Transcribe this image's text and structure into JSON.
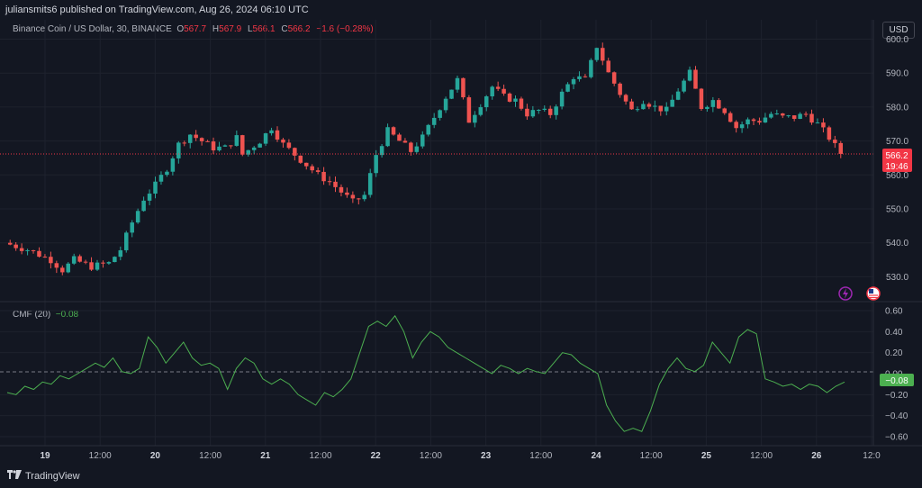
{
  "header": {
    "publisher": "juliansmits6 published on TradingView.com, Aug 26, 2024 06:10 UTC"
  },
  "symbol": {
    "title": "Binance Coin / US Dollar, 30, BINANCE",
    "o_label": "O",
    "o_value": "567.7",
    "h_label": "H",
    "h_value": "567.9",
    "l_label": "L",
    "l_value": "566.1",
    "c_label": "C",
    "c_value": "566.2",
    "change": "−1.6 (−0.28%)"
  },
  "currency_button": "USD",
  "price_badge": {
    "price": "566.2",
    "countdown": "19:46"
  },
  "indicator": {
    "name": "CMF (20)",
    "value": "−0.08",
    "badge": "−0.08"
  },
  "footer": {
    "brand": "TradingView"
  },
  "icons": [
    "lightning-icon",
    "us-flag-icon",
    "tradingview-logo-icon"
  ],
  "colors": {
    "up": "#26a69a",
    "down": "#ef5350",
    "cmf": "#4caf50",
    "badge": "#f23645",
    "background": "#131722"
  },
  "chart_data": [
    {
      "type": "candlestick",
      "title": "Binance Coin / US Dollar, 30, BINANCE",
      "x_ticks": [
        "19",
        "12:00",
        "20",
        "12:00",
        "21",
        "12:00",
        "22",
        "12:00",
        "23",
        "12:00",
        "24",
        "12:00",
        "25",
        "12:00",
        "26",
        "12:0"
      ],
      "y_ticks": [
        "530.0",
        "540.0",
        "550.0",
        "560.0",
        "570.0",
        "580.0",
        "590.0",
        "600.0"
      ],
      "ylim": [
        524,
        602
      ],
      "grid": true,
      "close_path": [
        [
          0,
          540
        ],
        [
          4,
          538
        ],
        [
          8,
          535
        ],
        [
          10,
          532
        ],
        [
          12,
          535
        ],
        [
          15,
          533
        ],
        [
          18,
          534
        ],
        [
          20,
          538
        ],
        [
          22,
          546
        ],
        [
          24,
          553
        ],
        [
          26,
          557
        ],
        [
          28,
          562
        ],
        [
          30,
          569
        ],
        [
          32,
          572
        ],
        [
          34,
          570
        ],
        [
          36,
          568
        ],
        [
          38,
          568
        ],
        [
          40,
          571
        ],
        [
          41,
          566
        ],
        [
          44,
          570
        ],
        [
          46,
          574
        ],
        [
          48,
          569
        ],
        [
          50,
          566
        ],
        [
          52,
          563
        ],
        [
          54,
          560
        ],
        [
          56,
          558
        ],
        [
          58,
          555
        ],
        [
          60,
          552
        ],
        [
          62,
          554
        ],
        [
          64,
          566
        ],
        [
          66,
          573
        ],
        [
          68,
          570
        ],
        [
          70,
          567
        ],
        [
          72,
          571
        ],
        [
          74,
          577
        ],
        [
          76,
          583
        ],
        [
          78,
          588
        ],
        [
          80,
          576
        ],
        [
          82,
          581
        ],
        [
          84,
          586
        ],
        [
          86,
          583
        ],
        [
          88,
          582
        ],
        [
          90,
          578
        ],
        [
          92,
          579
        ],
        [
          94,
          578
        ],
        [
          96,
          584
        ],
        [
          98,
          589
        ],
        [
          100,
          588
        ],
        [
          102,
          598
        ],
        [
          104,
          590
        ],
        [
          106,
          584
        ],
        [
          108,
          579
        ],
        [
          110,
          582
        ],
        [
          112,
          580
        ],
        [
          114,
          579
        ],
        [
          116,
          585
        ],
        [
          118,
          590
        ],
        [
          120,
          580
        ],
        [
          122,
          582
        ],
        [
          124,
          579
        ],
        [
          126,
          574
        ],
        [
          128,
          576
        ],
        [
          130,
          576
        ],
        [
          132,
          578
        ],
        [
          134,
          577
        ],
        [
          136,
          577
        ],
        [
          138,
          578
        ],
        [
          140,
          575
        ],
        [
          142,
          571
        ],
        [
          144,
          566
        ]
      ],
      "last_close": 566.2
    },
    {
      "type": "line",
      "title": "CMF (20)",
      "y_ticks": [
        "−0.60",
        "−0.40",
        "−0.20",
        "0.00",
        "0.20",
        "0.40",
        "0.60"
      ],
      "ylim": [
        -0.66,
        0.66
      ],
      "zero_line": true,
      "series": [
        {
          "values": [
            -0.18,
            -0.2,
            -0.12,
            -0.15,
            -0.08,
            -0.1,
            -0.02,
            -0.05,
            0.0,
            0.05,
            0.1,
            0.06,
            0.15,
            0.02,
            0.0,
            0.05,
            0.35,
            0.25,
            0.1,
            0.2,
            0.3,
            0.15,
            0.08,
            0.1,
            0.05,
            -0.15,
            0.05,
            0.15,
            0.1,
            -0.05,
            -0.1,
            -0.05,
            -0.1,
            -0.2,
            -0.25,
            -0.3,
            -0.18,
            -0.22,
            -0.15,
            -0.05,
            0.2,
            0.45,
            0.5,
            0.45,
            0.55,
            0.4,
            0.15,
            0.3,
            0.4,
            0.35,
            0.25,
            0.2,
            0.15,
            0.1,
            0.05,
            0.0,
            0.08,
            0.05,
            0.0,
            0.05,
            0.02,
            0.0,
            0.1,
            0.2,
            0.18,
            0.1,
            0.05,
            0.0,
            -0.3,
            -0.45,
            -0.55,
            -0.52,
            -0.55,
            -0.35,
            -0.1,
            0.05,
            0.15,
            0.05,
            0.02,
            0.08,
            0.3,
            0.2,
            0.1,
            0.35,
            0.42,
            0.38,
            -0.05,
            -0.08,
            -0.12,
            -0.1,
            -0.15,
            -0.1,
            -0.12,
            -0.18,
            -0.12,
            -0.08
          ]
        }
      ]
    }
  ]
}
